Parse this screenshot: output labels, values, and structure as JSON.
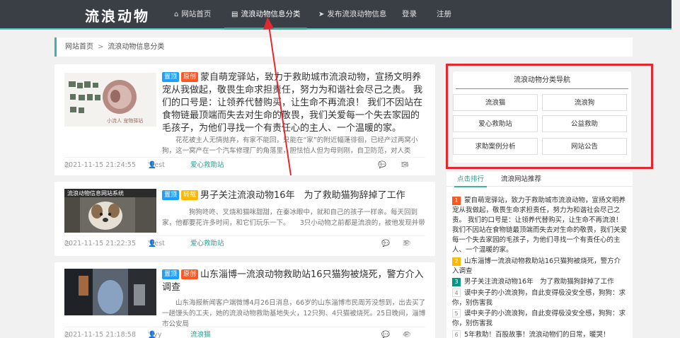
{
  "header": {
    "logo": "流浪动物",
    "nav": [
      {
        "icon": "home-icon",
        "glyph": "🏠",
        "label": "网站首页"
      },
      {
        "icon": "document-icon",
        "glyph": "📄",
        "label": "流浪动物信息分类"
      },
      {
        "icon": "send-icon",
        "glyph": "➤",
        "label": "发布流浪动物信息"
      },
      {
        "label": "登录"
      },
      {
        "label": "注册"
      }
    ]
  },
  "breadcrumb": {
    "home": "网站首页",
    "separator": ">",
    "current": "流浪动物信息分类"
  },
  "articles": [
    {
      "badges": [
        "置顶",
        "原创"
      ],
      "title": "蒙自萌宠驿站，致力于救助城市流浪动物，宣扬文明养宠从我做起，敬畏生命求担责任，努力为和谐社会尽己之责。 我们的口号是：让领养代替购买，让生命不再流浪！ 我们不因站在食物链最顶端而失去对生命的敬畏，我们关爱每一个失去家园的毛孩子，为他们寻找一个有责任心的主人、一个温暖的家。",
      "excerpt": "花花被主人无情抛弃，有家不能回，只能在“家”的附近幅蓬徘徊，已经产过两窝小狗，这一窝产在一个汽车修理厂的角落里，胆怯怕人但为母则刚，自卫防范，对人类",
      "date": "2021-11-15 21:24:55",
      "author": "' test",
      "category": "爱心救助站",
      "comments": "0",
      "views": "14"
    },
    {
      "badges": [
        "置顶",
        "转载"
      ],
      "title": "男子关注流浪动物16年　为了救助猫狗辞掉了工作",
      "thumb_text": "流浪动物信息网站系统",
      "excerpt": "狗狗咚咚、叉烧和猫咪甜甜，在秦冰眼中，就和自己的孩子一样亲。每天回到家，他都要花许多时间，和它们玩乐一下。　　3只小动物之前都是流浪的，被他发现并带",
      "date": "2021-11-15 21:22:35",
      "author": "' test",
      "category": "爱心救助站",
      "comments": "0",
      "views": "3"
    },
    {
      "badges": [
        "置顶",
        "原创"
      ],
      "title": "山东淄博一流浪动物救助站16只猫狗被烧死，警方介入调查",
      "excerpt": "山东海报新闻客户端微博4月26日消息，66岁的山东淄博市民周芳没想到，出去买了一趟馒头的工夫，她的流浪动物救助基地失火，12只狗、4只猫被烧死。25日晚间，淄博市公安局",
      "date": "2021-11-15 21:18:58",
      "author": "' lyy",
      "category": "流浪猫",
      "comments": "1",
      "views": "4"
    }
  ],
  "sidebar": {
    "title": "流浪动物分类导航",
    "categories": [
      "流浪猫",
      "流浪狗",
      "爱心救助站",
      "公益救助",
      "求助案例分析",
      "网站公告"
    ]
  },
  "ranking": {
    "tabs": [
      "点击排行",
      "流浪网站推荐"
    ],
    "items": [
      {
        "num": "1",
        "text": "蒙自萌宠驿站，致力于救助城市流浪动物，宣扬文明养宠从我做起，敬畏生命求担责任，努力为和谐社会尽己之责。 我们的口号是：让领养代替购买，让生命不再流浪！ 我们不因站在食物链最顶端而失去对生命的敬畏，我们关爱每一个失去家园的毛孩子，为他们寻找一个有责任心的主人、一个温暖的家。"
      },
      {
        "num": "2",
        "text": "山东淄博一流浪动物救助站16只猫狗被烧死，警方介入调查"
      },
      {
        "num": "3",
        "text": "男子关注流浪动物16年　为了救助猫狗辞掉了工作"
      },
      {
        "num": "4",
        "text": "谟中夹子的小流浪狗，自此变得极没安全感，狗狗：求你，别伤害我"
      },
      {
        "num": "5",
        "text": "谟中夹子的小流浪狗，自此变得极没安全感，狗狗：求你，别伤害我"
      },
      {
        "num": "6",
        "text": "5年救助！百股故事！流浪动物们的日常，暖哭！"
      }
    ]
  },
  "colors": {
    "accent": "#3bb3a6",
    "annotation": "#e22930",
    "nav_bg": "#3a3f45"
  }
}
